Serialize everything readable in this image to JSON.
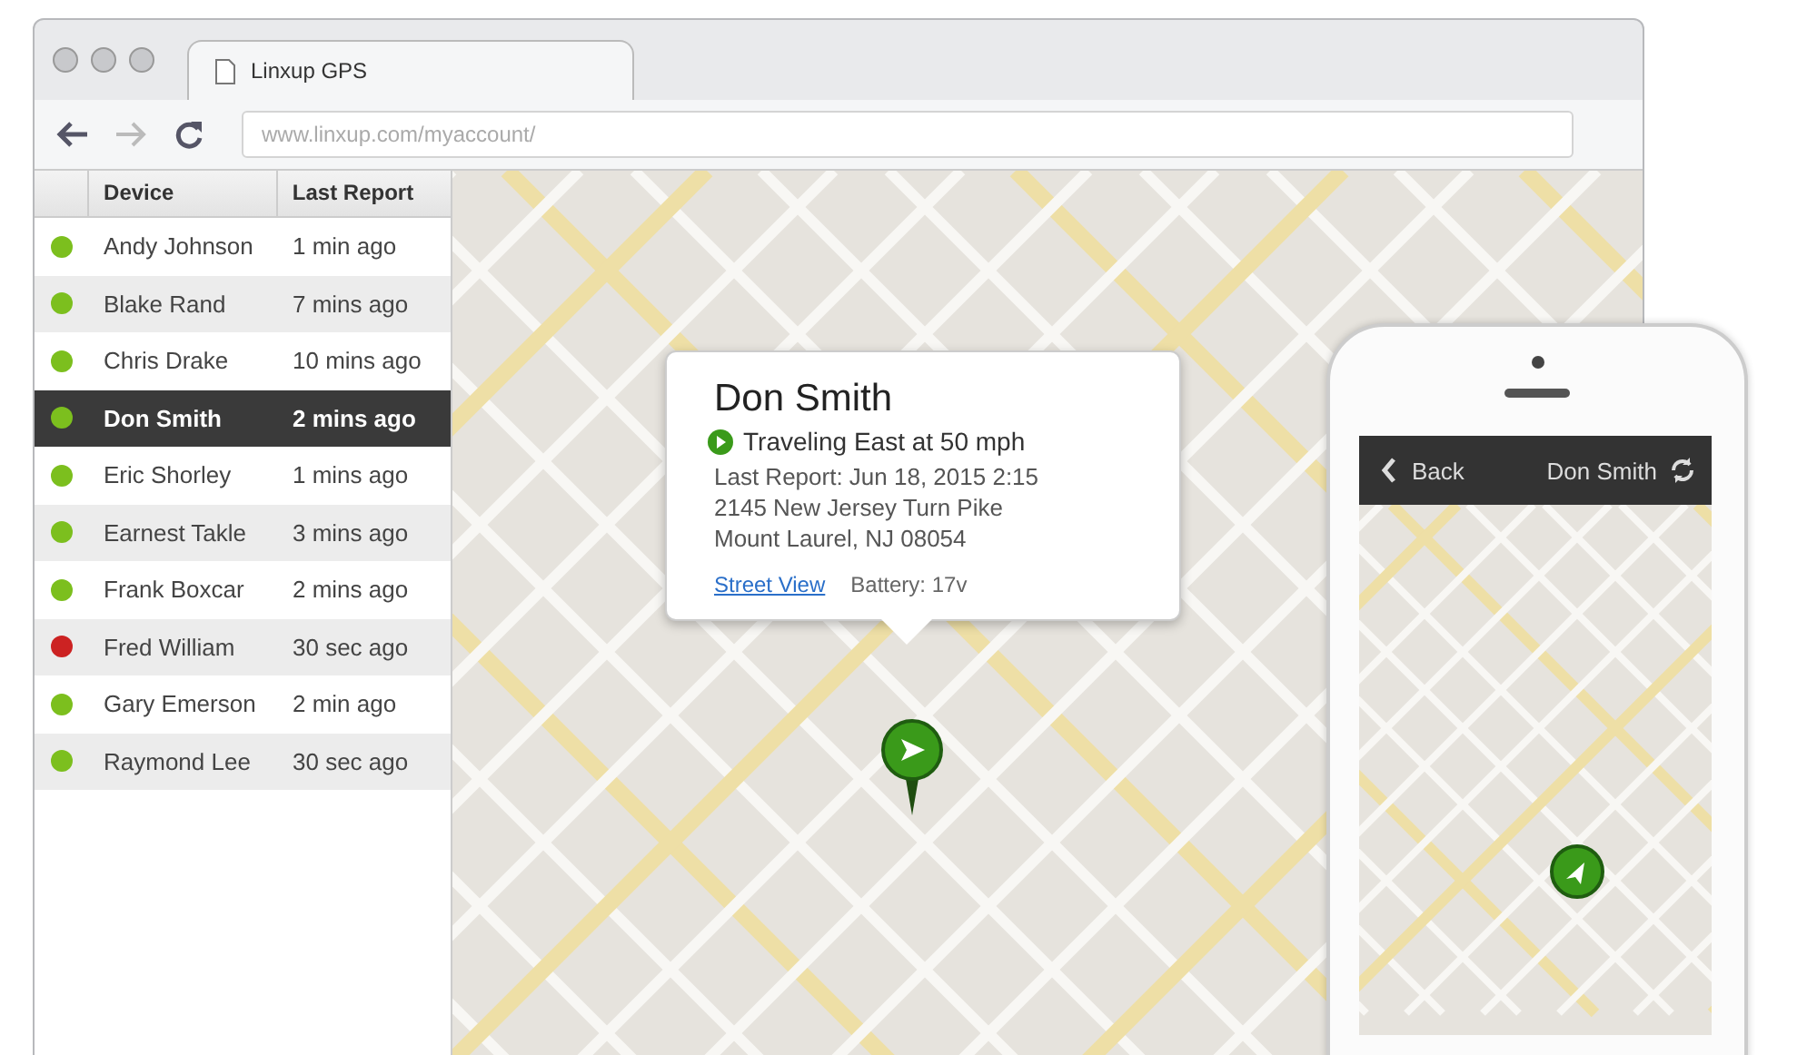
{
  "browser": {
    "tab_title": "Linxup GPS",
    "address": "www.linxup.com/myaccount/"
  },
  "table": {
    "columns": [
      "Device",
      "Last Report"
    ],
    "rows": [
      {
        "name": "Andy Johnson",
        "last_report": "1 min ago",
        "color": "#7cbf1e",
        "selected": false
      },
      {
        "name": "Blake Rand",
        "last_report": "7 mins ago",
        "color": "#7cbf1e",
        "selected": false
      },
      {
        "name": "Chris Drake",
        "last_report": "10 mins ago",
        "color": "#7cbf1e",
        "selected": false
      },
      {
        "name": "Don Smith",
        "last_report": "2 mins ago",
        "color": "#7cbf1e",
        "selected": true
      },
      {
        "name": "Eric Shorley",
        "last_report": "1 mins ago",
        "color": "#7cbf1e",
        "selected": false
      },
      {
        "name": "Earnest Takle",
        "last_report": "3 mins ago",
        "color": "#7cbf1e",
        "selected": false
      },
      {
        "name": "Frank Boxcar",
        "last_report": "2 mins ago",
        "color": "#7cbf1e",
        "selected": false
      },
      {
        "name": "Fred William",
        "last_report": "30 sec ago",
        "color": "#cc2222",
        "selected": false
      },
      {
        "name": "Gary Emerson",
        "last_report": "2 min ago",
        "color": "#7cbf1e",
        "selected": false
      },
      {
        "name": "Raymond Lee",
        "last_report": "30 sec ago",
        "color": "#7cbf1e",
        "selected": false
      }
    ]
  },
  "popup": {
    "name": "Don Smith",
    "status": "Traveling East at 50 mph",
    "last_report": "Last Report: Jun 18, 2015 2:15",
    "address_line_1": "2145 New Jersey Turn Pike",
    "address_line_2": "Mount Laurel, NJ 08054",
    "link": "Street View",
    "battery": "Battery: 17v"
  },
  "phone": {
    "back": "Back",
    "title": "Don Smith"
  }
}
